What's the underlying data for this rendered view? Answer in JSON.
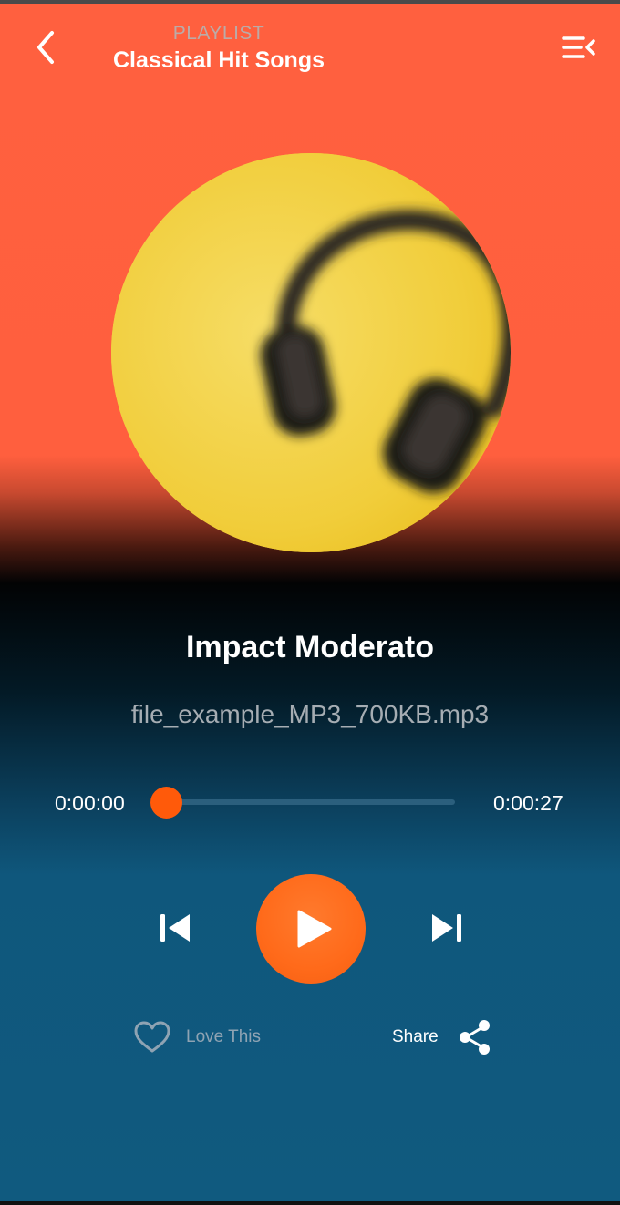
{
  "header": {
    "section_label": "PLAYLIST",
    "playlist_name": "Classical Hit Songs",
    "back_icon": "chevron-left-icon",
    "queue_icon": "queue-list-icon"
  },
  "album_art": {
    "subject": "headphones on yellow background"
  },
  "track": {
    "title": "Impact Moderato",
    "file_name": "file_example_MP3_700KB.mp3"
  },
  "player": {
    "current_time": "0:00:00",
    "total_time": "0:00:27",
    "progress": 0,
    "prev_icon": "skip-previous-icon",
    "play_icon": "play-icon",
    "next_icon": "skip-next-icon"
  },
  "actions": {
    "love_label": "Love This",
    "love_icon": "heart-outline-icon",
    "share_label": "Share",
    "share_icon": "share-icon"
  },
  "colors": {
    "header_bg": "#ff603f",
    "accent": "#ff5a0a",
    "bottom_bg": "#105a7f"
  }
}
